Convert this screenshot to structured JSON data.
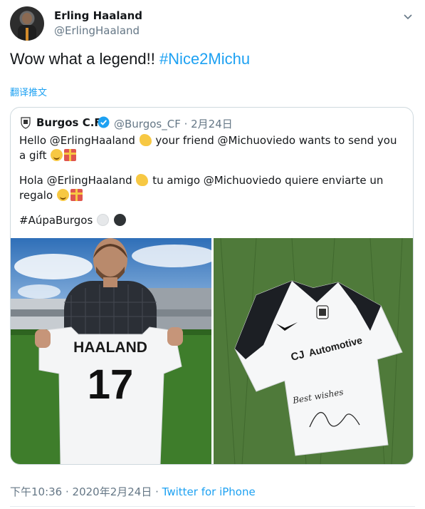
{
  "author": {
    "name": "Erling Haaland",
    "handle": "@ErlingHaaland"
  },
  "tweet": {
    "text_prefix": "Wow what a legend!! ",
    "hashtag": "#Nice2Michu",
    "translate_label": "翻译推文"
  },
  "quoted": {
    "name": "Burgos C.F.",
    "handle_date": "@Burgos_CF · 2月24日",
    "line1_a": "Hello @ErlingHaaland ",
    "line1_b": " your friend @Michuoviedo wants to send you a gift ",
    "line2_a": "Hola @ErlingHaaland ",
    "line2_b": " tu amigo @Michuoviedo quiere enviarte un regalo ",
    "hashtag": "#AúpaBurgos ",
    "photo_left": {
      "shirt_name": "HAALAND",
      "shirt_number": "17"
    },
    "photo_right": {
      "sponsor": "Automotive",
      "sponsor_logo": "CJ",
      "signature": "Best wishes"
    }
  },
  "footer": {
    "timestamp": "下午10:36 · 2020年2月24日 · ",
    "source": "Twitter for iPhone"
  },
  "colors": {
    "accent": "#1da1f2",
    "secondary_text": "#657786",
    "border": "#cfd9de"
  }
}
